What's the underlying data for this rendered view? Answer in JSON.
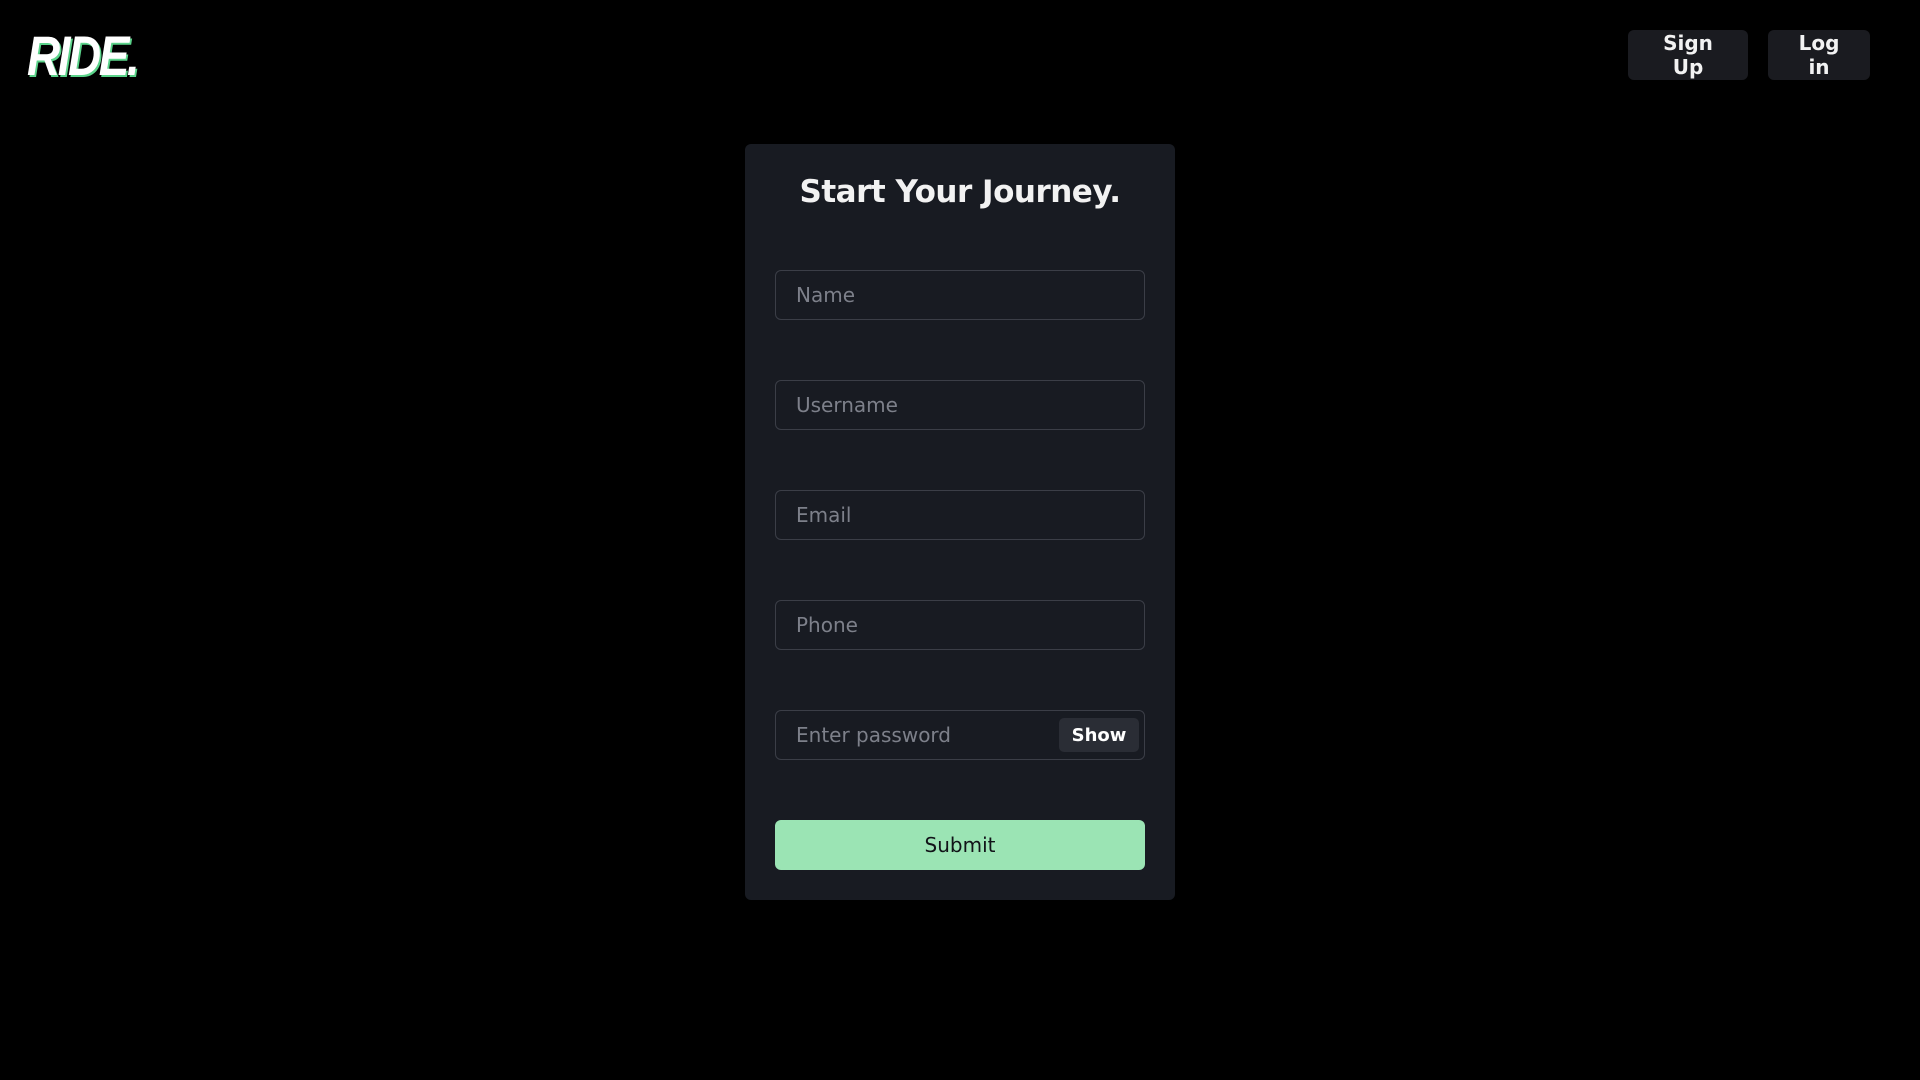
{
  "brand": {
    "logo_text": "RIDE."
  },
  "nav": {
    "signup_label": "Sign Up",
    "login_label": "Log in"
  },
  "form": {
    "title": "Start Your Journey.",
    "name_placeholder": "Name",
    "username_placeholder": "Username",
    "email_placeholder": "Email",
    "phone_placeholder": "Phone",
    "password_placeholder": "Enter password",
    "show_label": "Show",
    "submit_label": "Submit"
  },
  "colors": {
    "background": "#000000",
    "card": "#181b22",
    "accent": "#9be4b4",
    "nav_button": "#1a1b20"
  }
}
